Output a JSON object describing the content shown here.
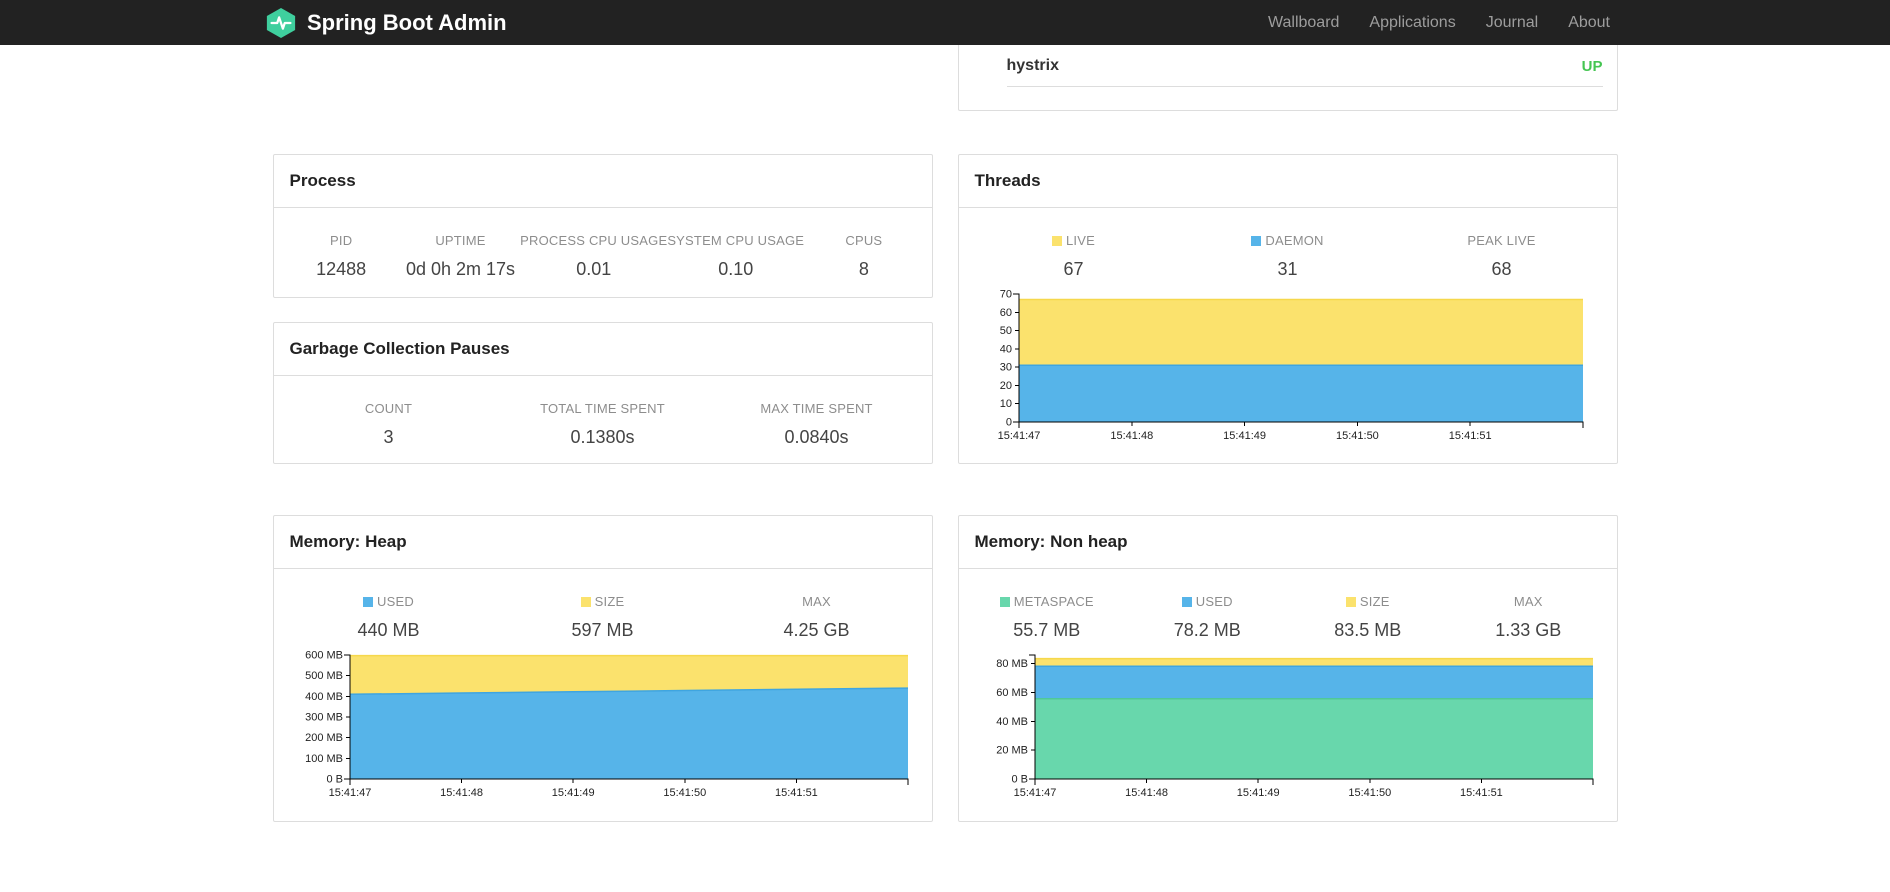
{
  "navbar": {
    "brand": "Spring Boot Admin",
    "links": [
      "Wallboard",
      "Applications",
      "Journal",
      "About"
    ]
  },
  "application_panel": {
    "name": "hystrix",
    "status": "UP",
    "status_color": "#45C552"
  },
  "panels": {
    "process": {
      "title": "Process",
      "stats": [
        {
          "label": "PID",
          "value": "12488"
        },
        {
          "label": "UPTIME",
          "value": "0d 0h 2m 17s"
        },
        {
          "label": "PROCESS CPU USAGE",
          "value": "0.01"
        },
        {
          "label": "SYSTEM CPU USAGE",
          "value": "0.10"
        },
        {
          "label": "CPUS",
          "value": "8"
        }
      ]
    },
    "gc": {
      "title": "Garbage Collection Pauses",
      "stats": [
        {
          "label": "COUNT",
          "value": "3"
        },
        {
          "label": "TOTAL TIME SPENT",
          "value": "0.1380s"
        },
        {
          "label": "MAX TIME SPENT",
          "value": "0.0840s"
        }
      ]
    },
    "threads": {
      "title": "Threads",
      "legend": [
        {
          "label": "LIVE",
          "value": "67",
          "color": "#FBE26D"
        },
        {
          "label": "DAEMON",
          "value": "31",
          "color": "#56B4E9"
        },
        {
          "label": "PEAK LIVE",
          "value": "68",
          "color": ""
        }
      ]
    },
    "memory_heap": {
      "title": "Memory: Heap",
      "legend": [
        {
          "label": "USED",
          "value": "440 MB",
          "color": "#56B4E9"
        },
        {
          "label": "SIZE",
          "value": "597 MB",
          "color": "#FBE26D"
        },
        {
          "label": "MAX",
          "value": "4.25 GB",
          "color": ""
        }
      ]
    },
    "memory_nonheap": {
      "title": "Memory: Non heap",
      "legend": [
        {
          "label": "METASPACE",
          "value": "55.7 MB",
          "color": "#68D7AC"
        },
        {
          "label": "USED",
          "value": "78.2 MB",
          "color": "#56B4E9"
        },
        {
          "label": "SIZE",
          "value": "83.5 MB",
          "color": ""
        },
        {
          "label": "MAX",
          "value": "1.33 GB",
          "color": ""
        }
      ]
    }
  },
  "chart_data": [
    {
      "id": "threads",
      "type": "area",
      "title": "Threads",
      "x": [
        "15:41:47",
        "15:41:48",
        "15:41:49",
        "15:41:50",
        "15:41:51"
      ],
      "ylim": [
        0,
        70
      ],
      "yticks": [
        {
          "v": 0,
          "label": "0"
        },
        {
          "v": 10,
          "label": "10"
        },
        {
          "v": 20,
          "label": "20"
        },
        {
          "v": 30,
          "label": "30"
        },
        {
          "v": 40,
          "label": "40"
        },
        {
          "v": 50,
          "label": "50"
        },
        {
          "v": 60,
          "label": "60"
        },
        {
          "v": 70,
          "label": "70"
        }
      ],
      "series": [
        {
          "name": "live",
          "color": "#FBE26D",
          "line": "#F6D84C",
          "values": [
            67,
            67,
            67,
            67,
            67,
            67
          ]
        },
        {
          "name": "daemon",
          "color": "#56B4E9",
          "line": "#3FA5E0",
          "values": [
            31,
            31,
            31,
            31,
            31,
            31
          ]
        }
      ]
    },
    {
      "id": "memory_heap",
      "type": "area",
      "title": "Memory: Heap",
      "x": [
        "15:41:47",
        "15:41:48",
        "15:41:49",
        "15:41:50",
        "15:41:51"
      ],
      "ylim": [
        0,
        600
      ],
      "yticks": [
        {
          "v": 0,
          "label": "0 B"
        },
        {
          "v": 100,
          "label": "100 MB"
        },
        {
          "v": 200,
          "label": "200 MB"
        },
        {
          "v": 300,
          "label": "300 MB"
        },
        {
          "v": 400,
          "label": "400 MB"
        },
        {
          "v": 500,
          "label": "500 MB"
        },
        {
          "v": 600,
          "label": "600 MB"
        }
      ],
      "series": [
        {
          "name": "size",
          "color": "#FBE26D",
          "line": "#F6D84C",
          "values": [
            597,
            597,
            597,
            597,
            597,
            597
          ]
        },
        {
          "name": "used",
          "color": "#56B4E9",
          "line": "#3FA5E0",
          "values": [
            410,
            416,
            422,
            428,
            434,
            440
          ]
        }
      ]
    },
    {
      "id": "memory_nonheap",
      "type": "area",
      "title": "Memory: Non heap",
      "x": [
        "15:41:47",
        "15:41:48",
        "15:41:49",
        "15:41:50",
        "15:41:51"
      ],
      "ylim": [
        0,
        86
      ],
      "yticks": [
        {
          "v": 0,
          "label": "0 B"
        },
        {
          "v": 20,
          "label": "20 MB"
        },
        {
          "v": 40,
          "label": "40 MB"
        },
        {
          "v": 60,
          "label": "60 MB"
        },
        {
          "v": 80,
          "label": "80 MB"
        }
      ],
      "series": [
        {
          "name": "size",
          "color": "#FBE26D",
          "line": "#F6D84C",
          "values": [
            83.5,
            83.5,
            83.5,
            83.5,
            83.5,
            83.5
          ]
        },
        {
          "name": "used",
          "color": "#56B4E9",
          "line": "#3FA5E0",
          "values": [
            78.2,
            78.2,
            78.2,
            78.2,
            78.2,
            78.2
          ]
        },
        {
          "name": "metaspace",
          "color": "#68D7AC",
          "line": "#4FC898",
          "values": [
            55.7,
            55.7,
            55.7,
            55.7,
            55.7,
            55.7
          ]
        }
      ]
    }
  ]
}
